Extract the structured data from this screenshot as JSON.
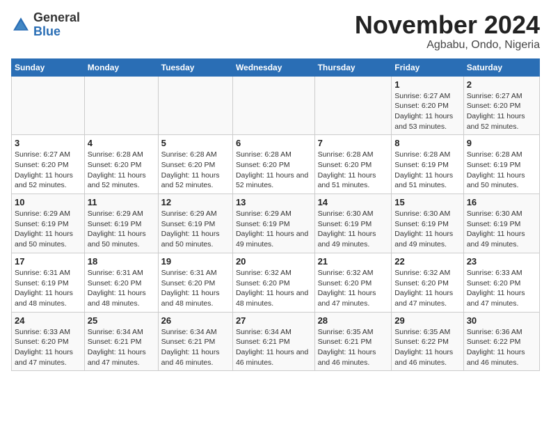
{
  "logo": {
    "general": "General",
    "blue": "Blue"
  },
  "title": "November 2024",
  "location": "Agbabu, Ondo, Nigeria",
  "days_header": [
    "Sunday",
    "Monday",
    "Tuesday",
    "Wednesday",
    "Thursday",
    "Friday",
    "Saturday"
  ],
  "weeks": [
    [
      {
        "day": "",
        "info": ""
      },
      {
        "day": "",
        "info": ""
      },
      {
        "day": "",
        "info": ""
      },
      {
        "day": "",
        "info": ""
      },
      {
        "day": "",
        "info": ""
      },
      {
        "day": "1",
        "info": "Sunrise: 6:27 AM\nSunset: 6:20 PM\nDaylight: 11 hours and 53 minutes."
      },
      {
        "day": "2",
        "info": "Sunrise: 6:27 AM\nSunset: 6:20 PM\nDaylight: 11 hours and 52 minutes."
      }
    ],
    [
      {
        "day": "3",
        "info": "Sunrise: 6:27 AM\nSunset: 6:20 PM\nDaylight: 11 hours and 52 minutes."
      },
      {
        "day": "4",
        "info": "Sunrise: 6:28 AM\nSunset: 6:20 PM\nDaylight: 11 hours and 52 minutes."
      },
      {
        "day": "5",
        "info": "Sunrise: 6:28 AM\nSunset: 6:20 PM\nDaylight: 11 hours and 52 minutes."
      },
      {
        "day": "6",
        "info": "Sunrise: 6:28 AM\nSunset: 6:20 PM\nDaylight: 11 hours and 52 minutes."
      },
      {
        "day": "7",
        "info": "Sunrise: 6:28 AM\nSunset: 6:20 PM\nDaylight: 11 hours and 51 minutes."
      },
      {
        "day": "8",
        "info": "Sunrise: 6:28 AM\nSunset: 6:19 PM\nDaylight: 11 hours and 51 minutes."
      },
      {
        "day": "9",
        "info": "Sunrise: 6:28 AM\nSunset: 6:19 PM\nDaylight: 11 hours and 50 minutes."
      }
    ],
    [
      {
        "day": "10",
        "info": "Sunrise: 6:29 AM\nSunset: 6:19 PM\nDaylight: 11 hours and 50 minutes."
      },
      {
        "day": "11",
        "info": "Sunrise: 6:29 AM\nSunset: 6:19 PM\nDaylight: 11 hours and 50 minutes."
      },
      {
        "day": "12",
        "info": "Sunrise: 6:29 AM\nSunset: 6:19 PM\nDaylight: 11 hours and 50 minutes."
      },
      {
        "day": "13",
        "info": "Sunrise: 6:29 AM\nSunset: 6:19 PM\nDaylight: 11 hours and 49 minutes."
      },
      {
        "day": "14",
        "info": "Sunrise: 6:30 AM\nSunset: 6:19 PM\nDaylight: 11 hours and 49 minutes."
      },
      {
        "day": "15",
        "info": "Sunrise: 6:30 AM\nSunset: 6:19 PM\nDaylight: 11 hours and 49 minutes."
      },
      {
        "day": "16",
        "info": "Sunrise: 6:30 AM\nSunset: 6:19 PM\nDaylight: 11 hours and 49 minutes."
      }
    ],
    [
      {
        "day": "17",
        "info": "Sunrise: 6:31 AM\nSunset: 6:19 PM\nDaylight: 11 hours and 48 minutes."
      },
      {
        "day": "18",
        "info": "Sunrise: 6:31 AM\nSunset: 6:20 PM\nDaylight: 11 hours and 48 minutes."
      },
      {
        "day": "19",
        "info": "Sunrise: 6:31 AM\nSunset: 6:20 PM\nDaylight: 11 hours and 48 minutes."
      },
      {
        "day": "20",
        "info": "Sunrise: 6:32 AM\nSunset: 6:20 PM\nDaylight: 11 hours and 48 minutes."
      },
      {
        "day": "21",
        "info": "Sunrise: 6:32 AM\nSunset: 6:20 PM\nDaylight: 11 hours and 47 minutes."
      },
      {
        "day": "22",
        "info": "Sunrise: 6:32 AM\nSunset: 6:20 PM\nDaylight: 11 hours and 47 minutes."
      },
      {
        "day": "23",
        "info": "Sunrise: 6:33 AM\nSunset: 6:20 PM\nDaylight: 11 hours and 47 minutes."
      }
    ],
    [
      {
        "day": "24",
        "info": "Sunrise: 6:33 AM\nSunset: 6:20 PM\nDaylight: 11 hours and 47 minutes."
      },
      {
        "day": "25",
        "info": "Sunrise: 6:34 AM\nSunset: 6:21 PM\nDaylight: 11 hours and 47 minutes."
      },
      {
        "day": "26",
        "info": "Sunrise: 6:34 AM\nSunset: 6:21 PM\nDaylight: 11 hours and 46 minutes."
      },
      {
        "day": "27",
        "info": "Sunrise: 6:34 AM\nSunset: 6:21 PM\nDaylight: 11 hours and 46 minutes."
      },
      {
        "day": "28",
        "info": "Sunrise: 6:35 AM\nSunset: 6:21 PM\nDaylight: 11 hours and 46 minutes."
      },
      {
        "day": "29",
        "info": "Sunrise: 6:35 AM\nSunset: 6:22 PM\nDaylight: 11 hours and 46 minutes."
      },
      {
        "day": "30",
        "info": "Sunrise: 6:36 AM\nSunset: 6:22 PM\nDaylight: 11 hours and 46 minutes."
      }
    ]
  ]
}
